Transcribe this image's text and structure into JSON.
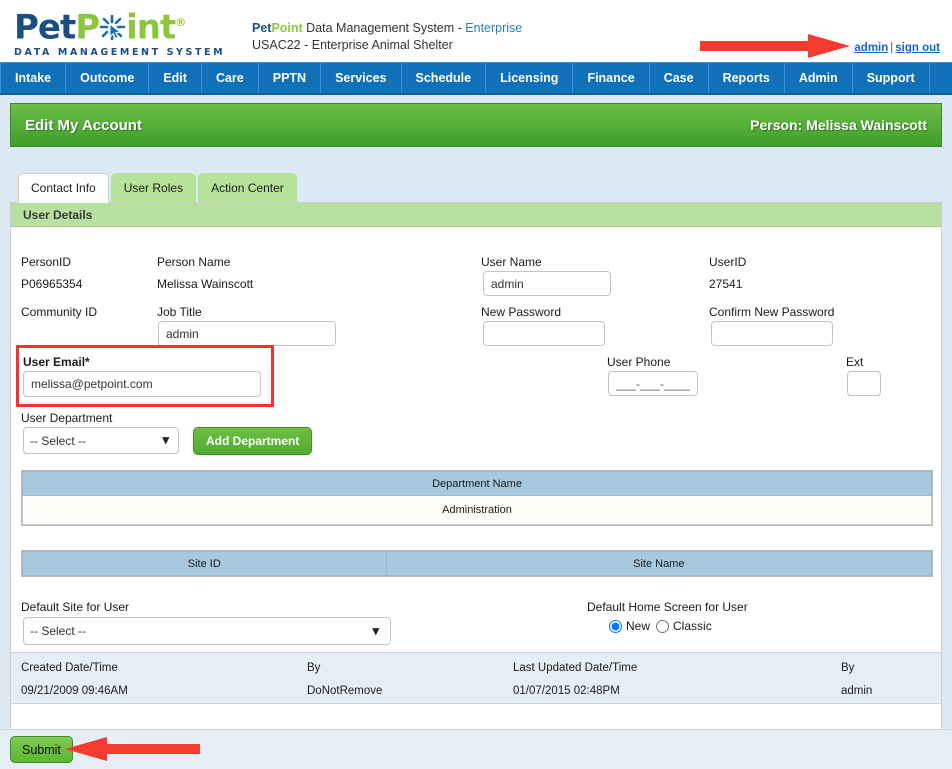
{
  "brand": {
    "logo_text_1": "Pet",
    "logo_text_2": "P",
    "logo_text_3": "int",
    "logo_tagline": "DATA MANAGEMENT SYSTEM",
    "logo_tm": "®"
  },
  "header": {
    "system_name_pet": "Pet",
    "system_name_point": "Point",
    "system_name_rest": " Data Management System - ",
    "edition": "Enterprise",
    "shelter_line": "USAC22 - Enterprise Animal Shelter",
    "account_link": "admin",
    "separator": "|",
    "signout_link": "sign out"
  },
  "nav": {
    "items": [
      {
        "label": "Intake"
      },
      {
        "label": "Outcome"
      },
      {
        "label": "Edit"
      },
      {
        "label": "Care"
      },
      {
        "label": "PPTN"
      },
      {
        "label": "Services"
      },
      {
        "label": "Schedule"
      },
      {
        "label": "Licensing"
      },
      {
        "label": "Finance"
      },
      {
        "label": "Case"
      },
      {
        "label": "Reports"
      },
      {
        "label": "Admin"
      },
      {
        "label": "Support"
      }
    ]
  },
  "page": {
    "title": "Edit My Account",
    "person": "Person: Melissa Wainscott"
  },
  "tabs": [
    {
      "label": "Contact Info",
      "active": true
    },
    {
      "label": "User Roles",
      "active": false
    },
    {
      "label": "Action Center",
      "active": false
    }
  ],
  "user_details": {
    "section_title": "User Details",
    "person_id_label": "PersonID",
    "person_id_value": "P06965354",
    "person_name_label": "Person Name",
    "person_name_value": "Melissa Wainscott",
    "user_name_label": "User Name",
    "user_name_value": "admin",
    "user_id_label": "UserID",
    "user_id_value": "27541",
    "community_id_label": "Community ID",
    "community_id_value": "",
    "job_title_label": "Job Title",
    "job_title_value": "admin",
    "new_password_label": "New Password",
    "new_password_value": "",
    "confirm_password_label": "Confirm New Password",
    "confirm_password_value": "",
    "user_email_label": "User Email*",
    "user_email_value": "melissa@petpoint.com",
    "user_phone_label": "User Phone",
    "user_phone_placeholder": "___-___-____",
    "ext_label": "Ext",
    "ext_value": "",
    "user_department_label": "User Department",
    "user_department_selected": "-- Select --",
    "add_department_button": "Add Department"
  },
  "department_grid": {
    "header": "Department Name",
    "rows": [
      "Administration"
    ]
  },
  "site_grid": {
    "headers": [
      "Site ID",
      "Site Name"
    ],
    "rows": []
  },
  "defaults": {
    "default_site_label": "Default Site for User",
    "default_site_selected": "-- Select --",
    "home_screen_label": "Default Home Screen for User",
    "home_screen_options": [
      {
        "label": "New",
        "selected": true
      },
      {
        "label": "Classic",
        "selected": false
      }
    ]
  },
  "audit": {
    "headers": [
      "Created Date/Time",
      "By",
      "Last Updated Date/Time",
      "By"
    ],
    "values": [
      "09/21/2009 09:46AM",
      "DoNotRemove",
      "01/07/2015 02:48PM",
      "admin"
    ]
  },
  "footer": {
    "submit_label": "Submit"
  },
  "annotations": {
    "arrow_color": "#f43b32",
    "highlight_color": "#f2342e",
    "arrow_top_target": "admin",
    "arrow_bottom_target": "Submit",
    "highlight_target": "User Email"
  },
  "colors": {
    "nav_blue": "#1070b8",
    "header_green": "#57b03a",
    "section_green": "#b8e0a0",
    "grid_header_blue": "#a8c8dd",
    "page_bg": "#dce9f2",
    "link_blue": "#1565c0"
  }
}
